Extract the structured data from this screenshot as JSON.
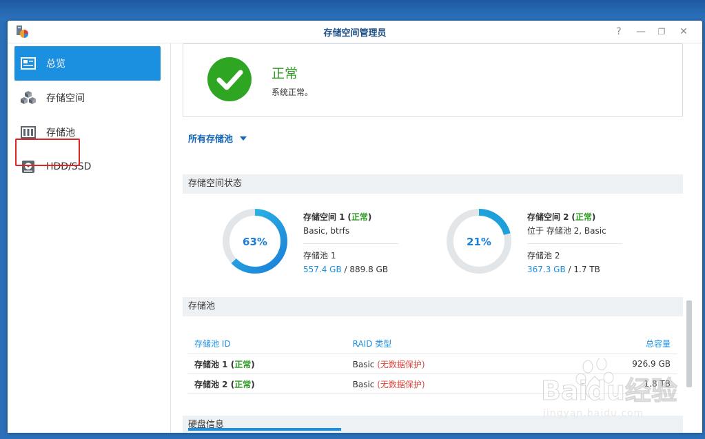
{
  "window": {
    "title": "存储空间管理员",
    "controls": [
      "?",
      "—",
      "❐",
      "✕"
    ]
  },
  "sidebar": {
    "items": [
      {
        "label": "总览",
        "icon": "overview-icon"
      },
      {
        "label": "存储空间",
        "icon": "cubes-icon"
      },
      {
        "label": "存储池",
        "icon": "storage-pool-icon"
      },
      {
        "label": "HDD/SSD",
        "icon": "disk-icon"
      }
    ],
    "active_index": 0
  },
  "status": {
    "title": "正常",
    "description": "系统正常。"
  },
  "filter": {
    "label": "所有存储池"
  },
  "sections": {
    "volume_status": "存储空间状态",
    "storage_pool": "存储池",
    "disk_info": "硬盘信息"
  },
  "volumes": [
    {
      "usage_percent": 63,
      "usage_label": "63%",
      "name": "存储空间 1",
      "status": "正常",
      "detail": "Basic, btrfs",
      "pool": "存储池 1",
      "used": "557.4 GB",
      "total": "889.8 GB"
    },
    {
      "usage_percent": 21,
      "usage_label": "21%",
      "name": "存储空间 2",
      "status": "正常",
      "detail": "位于 存储池 2, Basic",
      "pool": "存储池 2",
      "used": "367.3 GB",
      "total": "1.7 TB"
    }
  ],
  "pool_table": {
    "headers": {
      "id": "存储池 ID",
      "raid": "RAID 类型",
      "capacity": "总容量"
    },
    "rows": [
      {
        "id": "存储池 1",
        "status": "正常",
        "raid": "Basic",
        "raid_note": "(无数据保护)",
        "capacity": "926.9 GB"
      },
      {
        "id": "存储池 2",
        "status": "正常",
        "raid": "Basic",
        "raid_note": "(无数据保护)",
        "capacity": "1.8 TB"
      }
    ]
  },
  "watermark": {
    "brand": "Baidu经验",
    "url": "jingyan.baidu.com"
  },
  "colors": {
    "accent": "#1b8fe0",
    "ok_green": "#2e9a22",
    "warn_red": "#e0443a",
    "donut_track": "#e3e6e9",
    "donut_fill_start": "#2ec0e6",
    "donut_fill_end": "#1b7ed8"
  }
}
